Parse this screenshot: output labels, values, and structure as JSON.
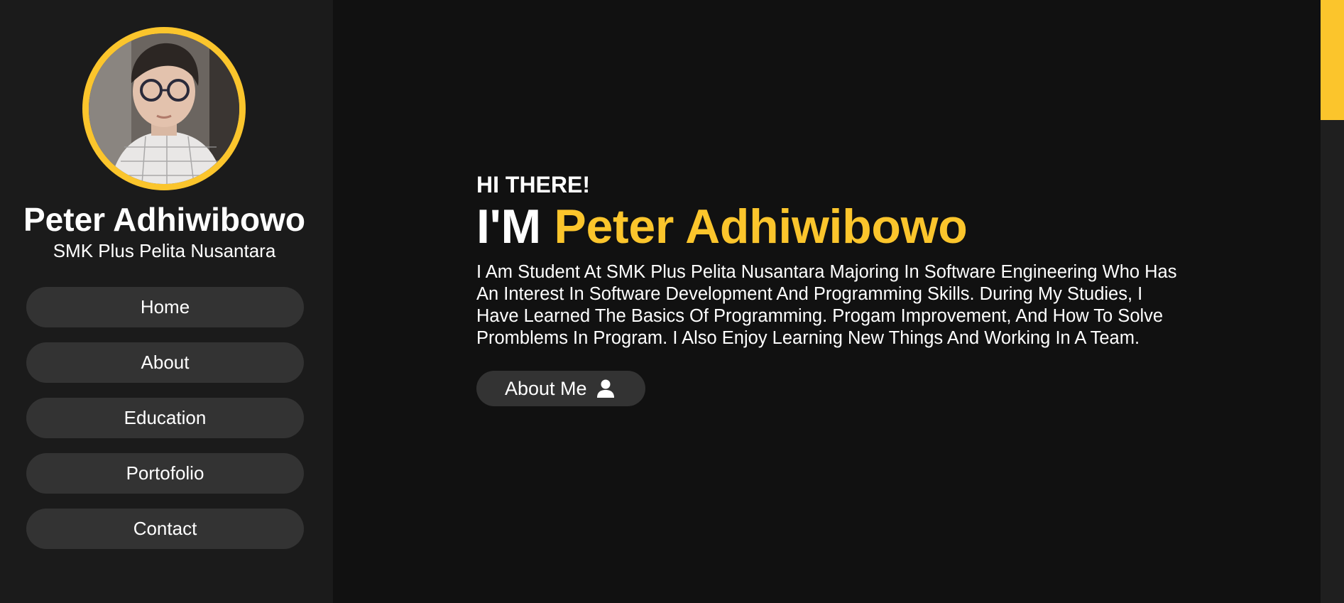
{
  "theme": {
    "accent": "#fbc52c",
    "sidebar_bg": "#1b1b1b",
    "main_bg": "#111111",
    "button_bg": "#333333",
    "text": "#ffffff"
  },
  "sidebar": {
    "avatar_icon": "profile-photo",
    "name": "Peter Adhiwibowo",
    "school": "SMK Plus Pelita Nusantara",
    "nav": [
      {
        "label": "Home"
      },
      {
        "label": "About"
      },
      {
        "label": "Education"
      },
      {
        "label": "Portofolio"
      },
      {
        "label": "Contact"
      }
    ]
  },
  "hero": {
    "greeting": "HI THERE!",
    "headline_prefix": "I'M",
    "headline_name": "Peter Adhiwibowo",
    "bio": "I Am Student At SMK Plus Pelita Nusantara Majoring In Software Engineering Who Has An Interest In Software Development And Programming Skills. During My Studies, I Have Learned The Basics Of Programming. Progam Improvement, And How To Solve Promblems In Program. I Also Enjoy Learning New Things And Working In A Team.",
    "button_label": "About Me",
    "button_icon": "user-icon"
  },
  "scrollbar": {
    "position_fraction": 0
  }
}
